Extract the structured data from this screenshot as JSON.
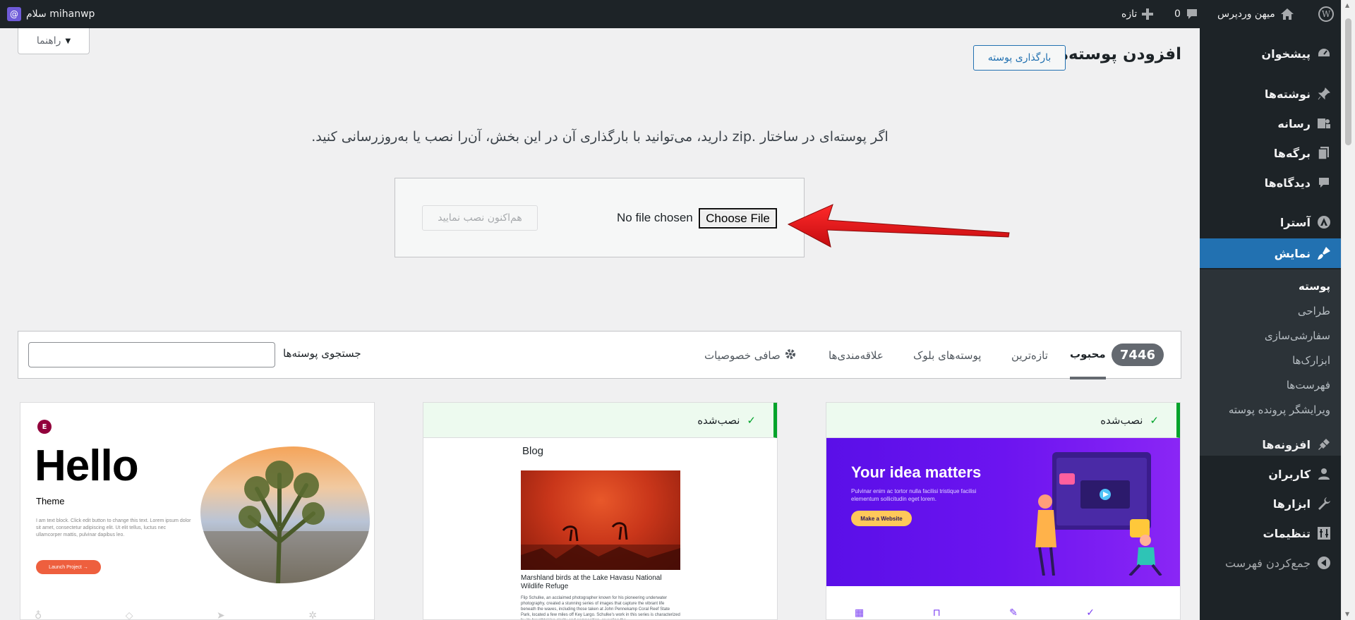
{
  "adminbar": {
    "site_name": "میهن وردپرس",
    "comments_count": "0",
    "new_label": "تازه",
    "greeting": "سلام mihanwp"
  },
  "sidebar": {
    "items": [
      {
        "label": "پیشخوان",
        "icon": "dashboard-icon"
      },
      {
        "label": "نوشته‌ها",
        "icon": "pin-icon"
      },
      {
        "label": "رسانه",
        "icon": "media-icon"
      },
      {
        "label": "برگه‌ها",
        "icon": "pages-icon"
      },
      {
        "label": "دیدگاه‌ها",
        "icon": "comments-icon"
      },
      {
        "label": "آسترا",
        "icon": "astra-icon"
      },
      {
        "label": "نمایش",
        "icon": "appearance-icon"
      },
      {
        "label": "افزونه‌ها",
        "icon": "plugins-icon"
      },
      {
        "label": "کاربران",
        "icon": "users-icon"
      },
      {
        "label": "ابزارها",
        "icon": "tools-icon"
      },
      {
        "label": "تنظیمات",
        "icon": "settings-icon"
      },
      {
        "label": "جمع‌کردن فهرست",
        "icon": "collapse-icon"
      }
    ],
    "submenu": [
      "پوسته",
      "طراحی",
      "سفارشی‌سازی",
      "ابزارک‌ها",
      "فهرست‌ها",
      "ویرایشگر پرونده پوسته"
    ]
  },
  "help_tab": "راهنما",
  "page": {
    "title": "افزودن پوسته‌ها",
    "upload_button": "بارگذاری پوسته",
    "intro": "اگر پوسته‌ای در ساختار .zip دارید، می‌توانید با بارگذاری آن در این بخش، آن‌را نصب یا به‌روزرسانی کنید."
  },
  "upload": {
    "no_file": "No file chosen",
    "choose_file": "Choose File",
    "install_now": "هم‌اکنون نصب نمایید"
  },
  "filter": {
    "count": "7446",
    "tabs": [
      "محبوب",
      "تازه‌ترین",
      "پوسته‌های بلوک",
      "علاقه‌مندی‌ها"
    ],
    "feature_filter": "صافی خصوصیات",
    "search_label": "جستجوی پوسته‌ها",
    "search_placeholder": ""
  },
  "cards": {
    "installed_label": "نصب‌شده",
    "astra": {
      "headline": "Your idea matters",
      "sub": "Pulvinar enim ac tortor nulla facilisi tristique facilisi elementum sollicitudin eget lorem.",
      "button": "Make a Website"
    },
    "blog": {
      "title": "Blog",
      "caption": "Marshland birds at the Lake Havasu National Wildlife Refuge",
      "text": "Flip Schulke, an acclaimed photographer known for his pioneering underwater photography, created a stunning series of images that capture the vibrant life beneath the waves, including those taken at John Pennekamp Coral Reef State Park, located a few miles off Key Largo. Schulke's work in this series is characterized by its breathtaking clarity and composition, revealing the"
    },
    "hello": {
      "title": "Hello",
      "subtitle": "Theme",
      "text": "I am text block. Click edit button to change this text. Lorem ipsum dolor sit amet, consectetur adipiscing elit. Ut elit tellus, luctus nec ullamcorper mattis, pulvinar dapibus leo.",
      "button": "Launch Project →"
    }
  },
  "colors": {
    "accent": "#2271b1",
    "installed": "#00a32a",
    "arrow": "#e8141a"
  }
}
